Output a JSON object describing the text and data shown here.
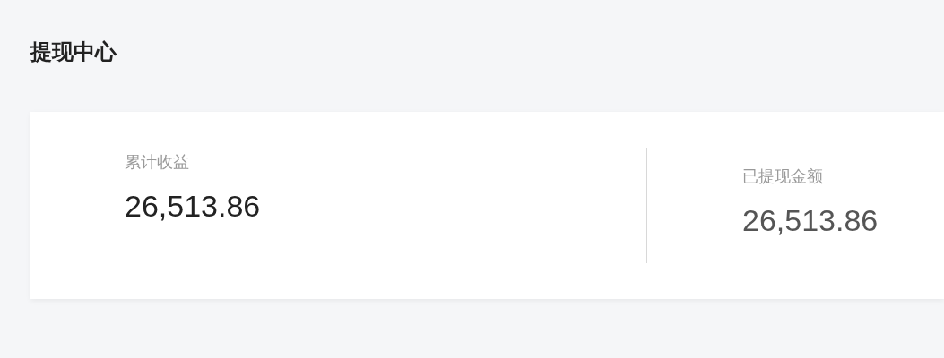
{
  "page": {
    "title": "提现中心"
  },
  "stats": [
    {
      "label": "累计收益",
      "value": "26,513.86"
    },
    {
      "label": "已提现金额",
      "value": "26,513.86"
    }
  ]
}
